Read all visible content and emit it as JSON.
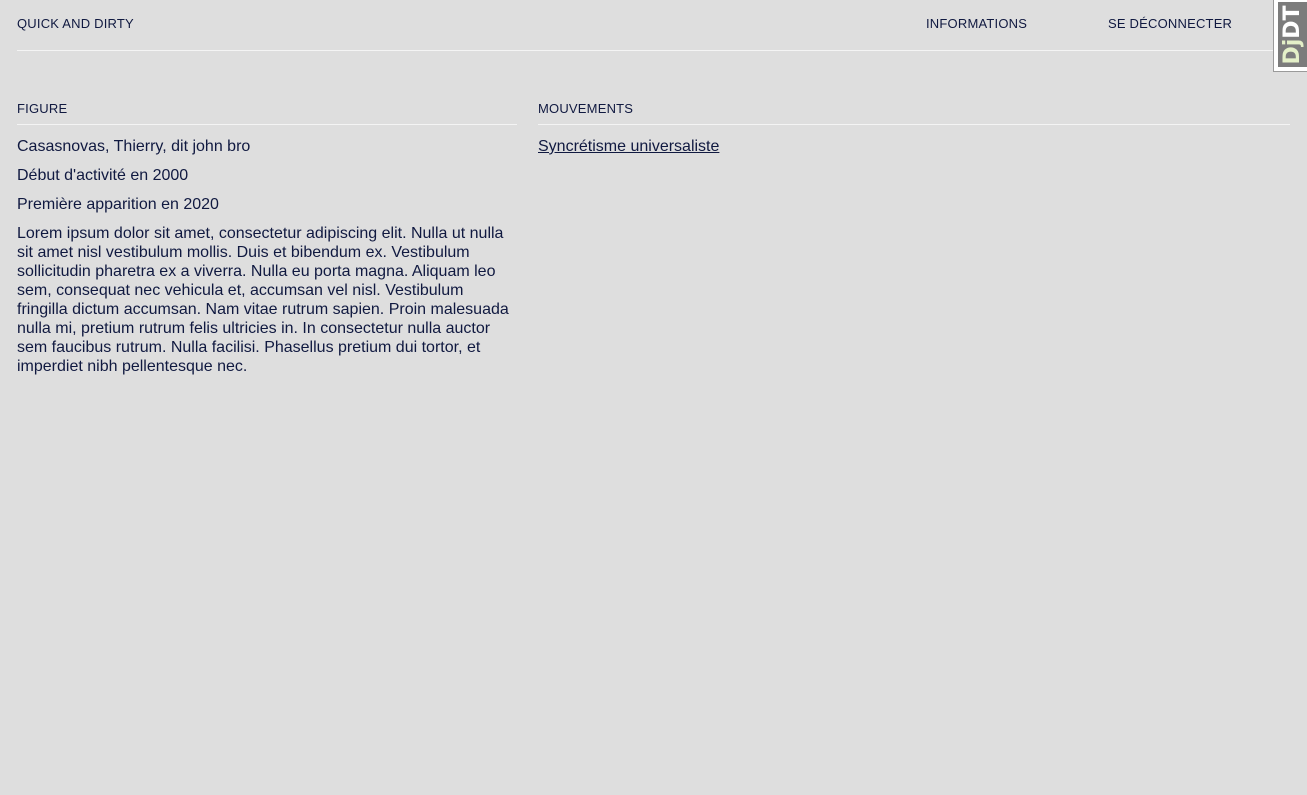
{
  "header": {
    "brand": "QUICK AND DIRTY",
    "nav": {
      "informations": "INFORMATIONS",
      "logout": "SE DÉCONNECTER"
    },
    "debug_toolbar_handle": {
      "dj": "Dj",
      "dt": "DT"
    }
  },
  "figure": {
    "section_title": "FIGURE",
    "name": "Casasnovas, Thierry, dit john bro",
    "activity_start": "Début d'activité en 2000",
    "first_appearance": "Première apparition en 2020",
    "bio": "Lorem ipsum dolor sit amet, consectetur adipiscing elit. Nulla ut nulla sit amet nisl vestibulum mollis. Duis et bibendum ex. Vestibulum sollicitudin pharetra ex a viverra. Nulla eu porta magna. Aliquam leo sem, consequat nec vehicula et, accumsan vel nisl. Vestibulum fringilla dictum accumsan. Nam vitae rutrum sapien. Proin malesuada nulla mi, pretium rutrum felis ultricies in. In consectetur nulla auctor sem faucibus rutrum. Nulla facilisi. Phasellus pretium dui tortor, et imperdiet nibh pellentesque nec."
  },
  "movements": {
    "section_title": "MOUVEMENTS",
    "items": [
      {
        "label": "Syncrétisme universaliste"
      }
    ]
  },
  "colors": {
    "background": "#dedede",
    "text": "#101940",
    "divider": "#f4f4f4",
    "toolbar_handle": "#7c7c7c",
    "toolbar_accent": "#e4f0c8"
  }
}
